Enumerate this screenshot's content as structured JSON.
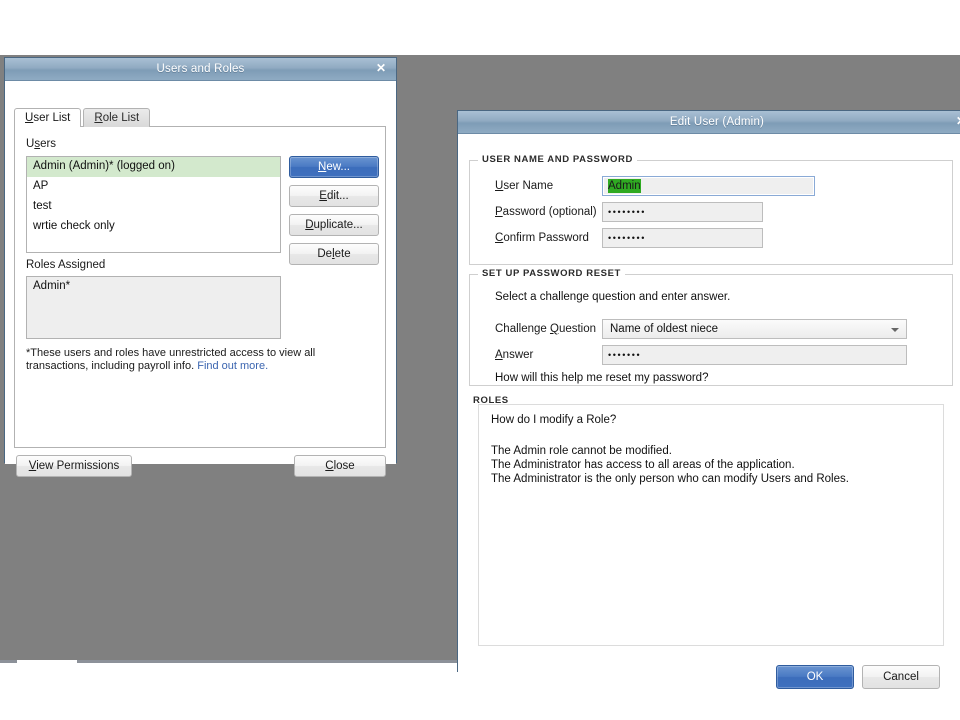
{
  "users_roles_dialog": {
    "title": "Users and Roles",
    "close_icon": "close-icon",
    "tabs": [
      {
        "label_pre": "U",
        "label_key": "s",
        "label_post": "er List",
        "label": "User List",
        "active": true
      },
      {
        "label": "Role List",
        "active": false
      }
    ],
    "users_label": "Users",
    "users": [
      {
        "name": "Admin (Admin)* (logged on)",
        "selected": true
      },
      {
        "name": "AP",
        "selected": false
      },
      {
        "name": "test",
        "selected": false
      },
      {
        "name": "wrtie check only",
        "selected": false
      }
    ],
    "side_buttons": [
      {
        "label": "New...",
        "primary": true
      },
      {
        "label": "Edit...",
        "primary": false
      },
      {
        "label": "Duplicate...",
        "primary": false
      },
      {
        "label": "Delete",
        "primary": false
      }
    ],
    "roles_assigned_label": "Roles Assigned",
    "roles_assigned": [
      {
        "name": "Admin*"
      }
    ],
    "note_line1": "*These users and roles have unrestricted access to view all",
    "note_line2": "transactions, including payroll info.",
    "note_link": "Find out more.",
    "view_permissions_label": "View Permissions",
    "close_label": "Close"
  },
  "edit_user_dialog": {
    "title": "Edit User (Admin)",
    "close_icon": "close-icon",
    "groups": {
      "credentials": {
        "legend": "USER NAME AND PASSWORD",
        "user_name_label": "User Name",
        "user_name_value": "Admin",
        "user_name_selected": true,
        "password_label": "Password (optional)",
        "password_value": "••••••••",
        "confirm_label": "Confirm Password",
        "confirm_value": "••••••••"
      },
      "password_reset": {
        "legend": "SET UP PASSWORD RESET",
        "instruction": "Select a challenge question and enter answer.",
        "challenge_label": "Challenge Question",
        "challenge_value": "Name of oldest niece",
        "answer_label": "Answer",
        "answer_value": "•••••••",
        "help_link": "How will this help me reset my password?"
      },
      "roles": {
        "legend": "ROLES",
        "help_link": "How do I modify a Role?",
        "body_lines": [
          "The Admin role cannot be modified.",
          "The Administrator has access to all areas of the application.",
          "The Administrator is the only person who can modify Users and Roles."
        ]
      }
    },
    "ok_label": "OK",
    "cancel_label": "Cancel"
  },
  "colors": {
    "titlebar_blue": "#8fabc3",
    "primary_button": "#4a7ac4",
    "selected_row_green": "#d3e9cd",
    "text_selection_green": "#2faa22",
    "link_blue": "#3b65b0",
    "backdrop_gray": "#808080"
  }
}
